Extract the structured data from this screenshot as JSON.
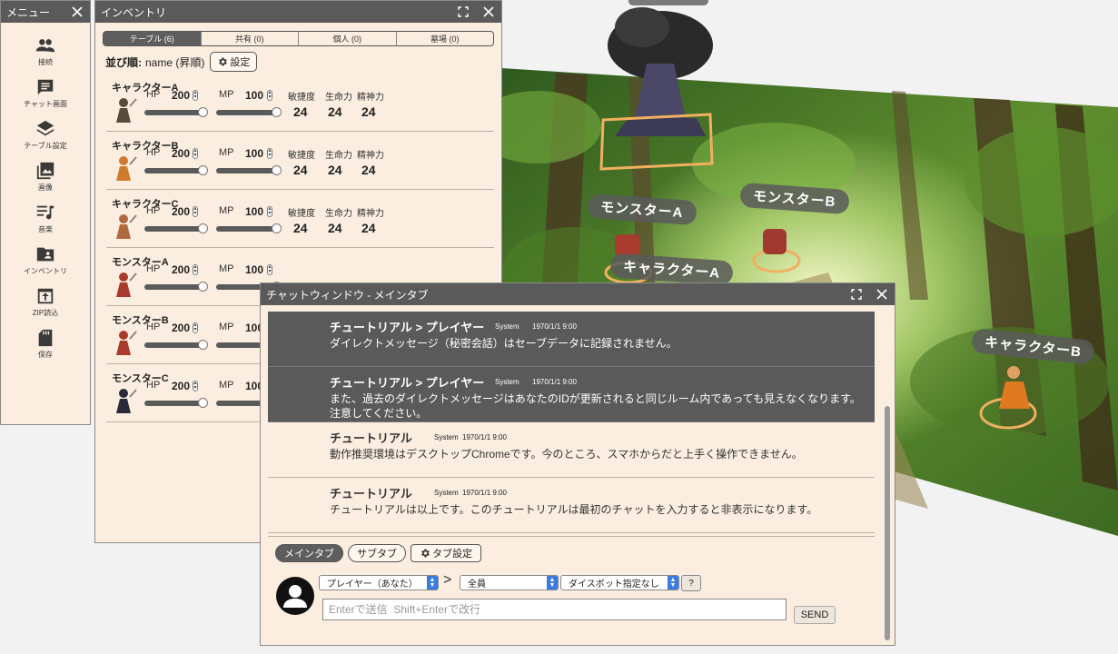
{
  "menu": {
    "title": "メニュー",
    "items": [
      {
        "label": "接続",
        "icon": "people-icon"
      },
      {
        "label": "チャット画面",
        "icon": "chat-icon"
      },
      {
        "label": "テーブル設定",
        "icon": "layers-icon"
      },
      {
        "label": "画像",
        "icon": "image-icon"
      },
      {
        "label": "音楽",
        "icon": "music-icon"
      },
      {
        "label": "インベントリ",
        "icon": "folder-icon"
      },
      {
        "label": "ZIP読込",
        "icon": "upload-icon"
      },
      {
        "label": "保存",
        "icon": "sd-card-icon"
      }
    ]
  },
  "inventory": {
    "title": "インベントリ",
    "tabs": [
      "テーブル (6)",
      "共有 (0)",
      "個人 (0)",
      "墓場 (0)"
    ],
    "sort_label": "並び順:",
    "sort_value": "name (昇順)",
    "settings_label": "設定",
    "stat_labels": {
      "hp": "HP",
      "mp": "MP",
      "agi": "敏捷度",
      "vit": "生命力",
      "spi": "精神力"
    },
    "characters": [
      {
        "name": "キャラクターA",
        "hp": "200",
        "mp": "100",
        "agi": "24",
        "vit": "24",
        "spi": "24",
        "hp_fill": 1.0,
        "mp_fill": 1.0
      },
      {
        "name": "キャラクターB",
        "hp": "200",
        "mp": "100",
        "agi": "24",
        "vit": "24",
        "spi": "24",
        "hp_fill": 1.0,
        "mp_fill": 1.0
      },
      {
        "name": "キャラクターC",
        "hp": "200",
        "mp": "100",
        "agi": "24",
        "vit": "24",
        "spi": "24",
        "hp_fill": 1.0,
        "mp_fill": 1.0
      },
      {
        "name": "モンスターA",
        "hp": "200",
        "mp": "100",
        "hp_fill": 1.0
      },
      {
        "name": "モンスターB",
        "hp": "200",
        "mp": "100",
        "hp_fill": 1.0
      },
      {
        "name": "モンスターC",
        "hp": "200",
        "mp": "100",
        "hp_fill": 1.0
      }
    ]
  },
  "board": {
    "labels": [
      "モンスターA",
      "モンスターB",
      "キャラクターA",
      "キャラクターB"
    ]
  },
  "chat": {
    "title": "チャットウィンドウ - メインタブ",
    "messages": [
      {
        "from": "チュートリアル > プレイヤー",
        "system": "System",
        "time": "1970/1/1 9:00",
        "text": "ダイレクトメッセージ（秘密会話）はセーブデータに記録されません。",
        "dm": true
      },
      {
        "from": "チュートリアル > プレイヤー",
        "system": "System",
        "time": "1970/1/1 9:00",
        "text": "また、過去のダイレクトメッセージはあなたのIDが更新されると同じルーム内であっても見えなくなります。注意してください。",
        "dm": true
      },
      {
        "from": "チュートリアル",
        "system": "System",
        "time": "1970/1/1 9:00",
        "text": "動作推奨環境はデスクトップChromeです。今のところ、スマホからだと上手く操作できません。",
        "dm": false
      },
      {
        "from": "チュートリアル",
        "system": "System",
        "time": "1970/1/1 9:00",
        "text": "チュートリアルは以上です。このチュートリアルは最初のチャットを入力すると非表示になります。",
        "dm": false
      }
    ],
    "tabs": [
      "メインタブ",
      "サブタブ"
    ],
    "tab_settings_label": "タブ設定",
    "sender": "プレイヤー（あなた）",
    "separator": ">",
    "target": "全員",
    "dicebot": "ダイスボット指定なし",
    "help_label": "?",
    "input_placeholder": "Enterで送信  Shift+Enterで改行",
    "send_label": "SEND"
  },
  "colors": {
    "title_bar": "#5a5a5a",
    "window_bg": "#fbeee0",
    "select_arrow": "#3b7be0"
  }
}
